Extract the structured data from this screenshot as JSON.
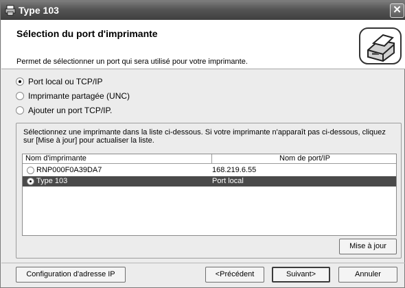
{
  "window": {
    "title": "Type 103",
    "close_glyph": "✕"
  },
  "header": {
    "title": "Sélection du port d'imprimante",
    "subtitle": "Permet de sélectionner un port qui sera utilisé pour votre imprimante.",
    "art_icon": "printer-icon"
  },
  "options": [
    {
      "label": "Port local ou TCP/IP",
      "checked": true
    },
    {
      "label": "Imprimante partagée (UNC)",
      "checked": false
    },
    {
      "label": "Ajouter un port TCP/IP.",
      "checked": false
    }
  ],
  "group": {
    "instructions": "Sélectionnez une imprimante dans la liste ci-dessous. Si votre imprimante n'apparaît pas ci-dessous, cliquez sur [Mise à jour] pour actualiser la liste.",
    "columns": [
      "Nom d'imprimante",
      "Nom de port/IP"
    ],
    "rows": [
      {
        "name": "RNP000F0A39DA7",
        "port": "168.219.6.55",
        "selected": false
      },
      {
        "name": "Type 103",
        "port": "Port local",
        "selected": true
      }
    ],
    "refresh_label": "Mise à jour"
  },
  "footer": {
    "config_label": "Configuration d'adresse IP",
    "back_label": "<Précédent",
    "next_label": "Suivant>",
    "cancel_label": "Annuler"
  },
  "colors": {
    "titlebar": "#555555",
    "selection": "#4a4a4a",
    "dialog_bg": "#ececec"
  }
}
